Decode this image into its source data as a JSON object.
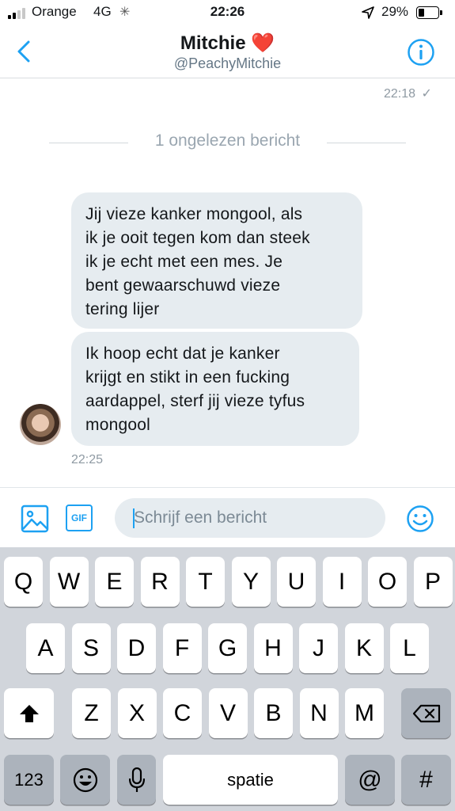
{
  "status_bar": {
    "carrier": "Orange",
    "network": "4G",
    "time": "22:26",
    "battery": "29%",
    "battery_level": 0.29
  },
  "header": {
    "name": "Mitchie",
    "name_emoji": "❤️",
    "handle": "@PeachyMitchie",
    "back_icon": "chevron-left-icon",
    "info_icon": "info-icon"
  },
  "conversation": {
    "last_read_time": "22:18",
    "read_mark": "✓",
    "unread_divider": "1 ongelezen bericht",
    "messages": [
      {
        "text": "Jij vieze kanker mongool, als\nik je ooit tegen kom dan steek\nik je echt met een mes. Je\nbent gewaarschuwd vieze\ntering lijer"
      },
      {
        "text": "Ik hoop echt dat je kanker\nkrijgt en stikt in een fucking\naardappel, sterf jij vieze tyfus\nmongool"
      }
    ],
    "message_time": "22:25"
  },
  "compose": {
    "placeholder": "Schrijf een bericht",
    "value": "",
    "gif_label": "GIF"
  },
  "keyboard": {
    "row1": [
      "Q",
      "W",
      "E",
      "R",
      "T",
      "Y",
      "U",
      "I",
      "O",
      "P"
    ],
    "row2": [
      "A",
      "S",
      "D",
      "F",
      "G",
      "H",
      "J",
      "K",
      "L"
    ],
    "row3": [
      "Z",
      "X",
      "C",
      "V",
      "B",
      "N",
      "M"
    ],
    "numbers_key": "123",
    "space_key": "spatie",
    "at_key": "@",
    "hash_key": "#"
  },
  "colors": {
    "accent": "#1da1f2",
    "bubble": "#e6ecf0",
    "keyboard_bg": "#d1d5db",
    "special_key": "#acb3bc"
  }
}
